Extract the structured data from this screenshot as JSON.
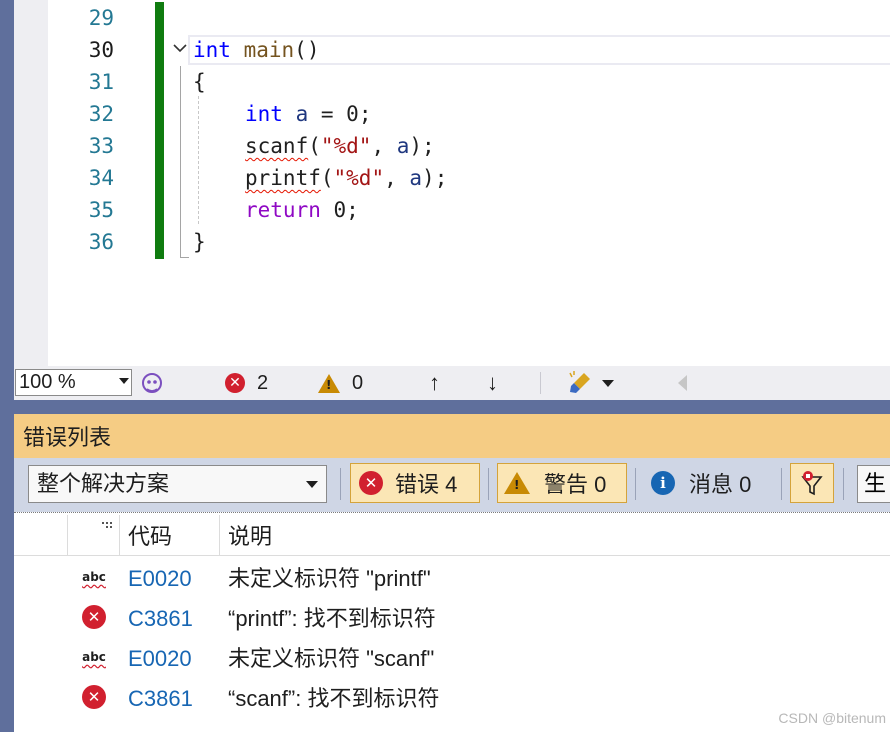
{
  "editor": {
    "line_numbers": [
      "29",
      "30",
      "31",
      "32",
      "33",
      "34",
      "35",
      "36"
    ],
    "lines": {
      "l30_kw": "int",
      "l30_fn": "main",
      "l30_rest": "()",
      "l31": "{",
      "l32_kw": "int",
      "l32_var": "a",
      "l32_rest": " = 0;",
      "l33_fn": "scanf",
      "l33_p1": "(",
      "l33_str": "\"%d\"",
      "l33_p2": ", ",
      "l33_var": "a",
      "l33_p3": ");",
      "l34_fn": "printf",
      "l34_p1": "(",
      "l34_str": "\"%d\"",
      "l34_p2": ", ",
      "l34_var": "a",
      "l34_p3": ");",
      "l35_kw": "return",
      "l35_rest": " 0;",
      "l36": "}"
    }
  },
  "statusbar": {
    "zoom": "100 %",
    "error_count": "2",
    "warning_count": "0",
    "up_arrow": "↑",
    "down_arrow": "↓"
  },
  "error_list": {
    "title": "错误列表",
    "scope": "整个解决方案",
    "errors_label": "错误 4",
    "warnings_label": "警告 0",
    "messages_label": "消息 0",
    "build_label": "生",
    "columns": {
      "code": "代码",
      "description": "说明"
    },
    "rows": [
      {
        "type": "intellisense",
        "code": "E0020",
        "description": "未定义标识符 \"printf\""
      },
      {
        "type": "error",
        "code": "C3861",
        "description": "“printf”: 找不到标识符"
      },
      {
        "type": "intellisense",
        "code": "E0020",
        "description": "未定义标识符 \"scanf\""
      },
      {
        "type": "error",
        "code": "C3861",
        "description": "“scanf”: 找不到标识符"
      }
    ]
  },
  "watermark": "CSDN @bitenum",
  "colors": {
    "accent_tab": "#f5cc84",
    "change_bar": "#107c10",
    "error_red": "#d1202f",
    "warning_amber": "#c88a04",
    "info_blue": "#1766b3"
  },
  "icons": {
    "error": "error-circle-icon",
    "warning": "warning-triangle-icon",
    "info": "info-circle-icon",
    "spell": "abc-squiggle-icon",
    "filter": "filter-icon",
    "cleanup": "brush-icon",
    "copilot": "copilot-icon"
  }
}
